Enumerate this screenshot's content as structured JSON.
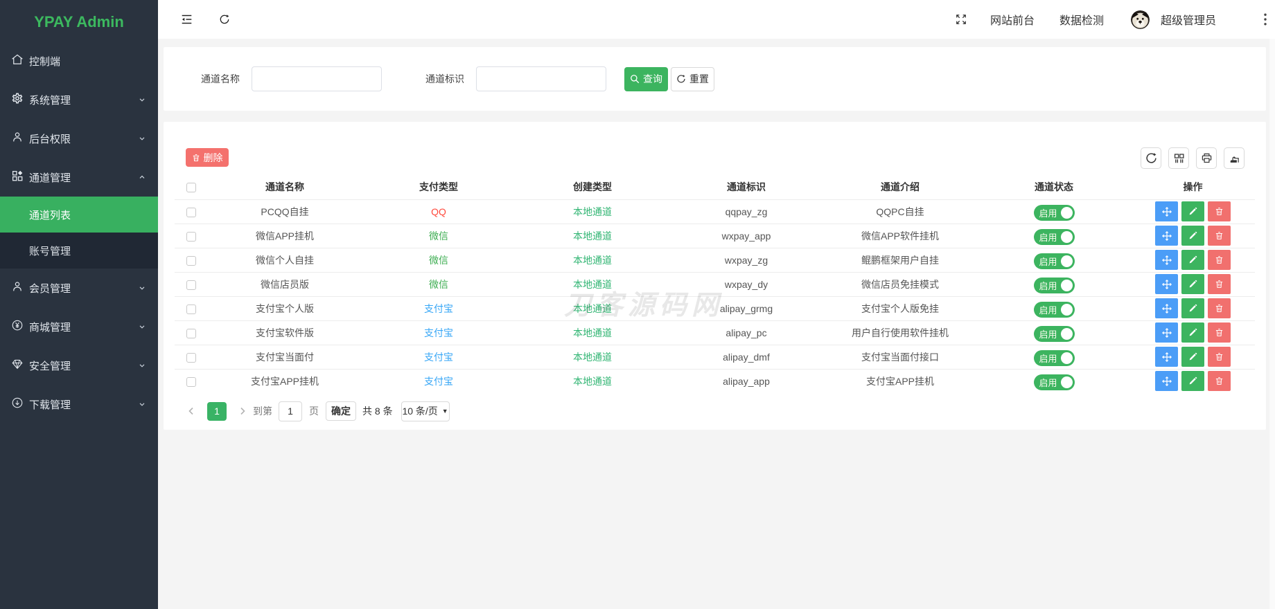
{
  "app": {
    "colors": {
      "accent_green": "#3cb45f",
      "sidebar_bg": "#2a333f",
      "active_green": "#38b060",
      "danger_red": "#f4716d",
      "action_blue": "#4b9df7",
      "link_green": "#31b573",
      "qq_red": "#ff4a3d",
      "wechat_green": "#3fae53",
      "alipay_blue": "#36a6f6"
    }
  },
  "sidebar": {
    "logo": "YPAY Admin",
    "items": [
      {
        "label": "控制端",
        "icon": "home-icon"
      },
      {
        "label": "系统管理",
        "icon": "gear-icon"
      },
      {
        "label": "后台权限",
        "icon": "user-icon"
      },
      {
        "label": "通道管理",
        "icon": "apps-icon",
        "expanded": true,
        "children": [
          {
            "label": "通道列表",
            "active": true
          },
          {
            "label": "账号管理"
          }
        ]
      },
      {
        "label": "会员管理",
        "icon": "user-icon"
      },
      {
        "label": "商城管理",
        "icon": "yen-icon"
      },
      {
        "label": "安全管理",
        "icon": "gem-icon"
      },
      {
        "label": "下载管理",
        "icon": "download-icon"
      }
    ]
  },
  "topbar": {
    "site_link": "网站前台",
    "data_link": "数据检测",
    "user_name": "超级管理员"
  },
  "filters": {
    "name_label": "通道名称",
    "name_value": "",
    "code_label": "通道标识",
    "code_value": "",
    "search_label": "查询",
    "reset_label": "重置"
  },
  "toolbar": {
    "delete_label": "删除"
  },
  "table": {
    "headers": [
      "通道名称",
      "支付类型",
      "创建类型",
      "通道标识",
      "通道介绍",
      "通道状态",
      "操作"
    ],
    "status_on_label": "启用",
    "rows": [
      {
        "name": "PCQQ自挂",
        "pay_type": "QQ",
        "pay_color": "#ff4a3d",
        "create_type": "本地通道",
        "code": "qqpay_zg",
        "desc": "QQPC自挂"
      },
      {
        "name": "微信APP挂机",
        "pay_type": "微信",
        "pay_color": "#3fae53",
        "create_type": "本地通道",
        "code": "wxpay_app",
        "desc": "微信APP软件挂机"
      },
      {
        "name": "微信个人自挂",
        "pay_type": "微信",
        "pay_color": "#3fae53",
        "create_type": "本地通道",
        "code": "wxpay_zg",
        "desc": "鲲鹏框架用户自挂"
      },
      {
        "name": "微信店员版",
        "pay_type": "微信",
        "pay_color": "#3fae53",
        "create_type": "本地通道",
        "code": "wxpay_dy",
        "desc": "微信店员免挂模式"
      },
      {
        "name": "支付宝个人版",
        "pay_type": "支付宝",
        "pay_color": "#36a6f6",
        "create_type": "本地通道",
        "code": "alipay_grmg",
        "desc": "支付宝个人版免挂"
      },
      {
        "name": "支付宝软件版",
        "pay_type": "支付宝",
        "pay_color": "#36a6f6",
        "create_type": "本地通道",
        "code": "alipay_pc",
        "desc": "用户自行使用软件挂机"
      },
      {
        "name": "支付宝当面付",
        "pay_type": "支付宝",
        "pay_color": "#36a6f6",
        "create_type": "本地通道",
        "code": "alipay_dmf",
        "desc": "支付宝当面付接口"
      },
      {
        "name": "支付宝APP挂机",
        "pay_type": "支付宝",
        "pay_color": "#36a6f6",
        "create_type": "本地通道",
        "code": "alipay_app",
        "desc": "支付宝APP挂机"
      }
    ]
  },
  "pagination": {
    "current_page": "1",
    "goto_label": "到第",
    "page_value": "1",
    "page_suffix": "页",
    "confirm_label": "确定",
    "total_label": "共 8 条",
    "page_size_label": "10 条/页",
    "caret": "▼"
  },
  "watermark": "刀客源码网"
}
